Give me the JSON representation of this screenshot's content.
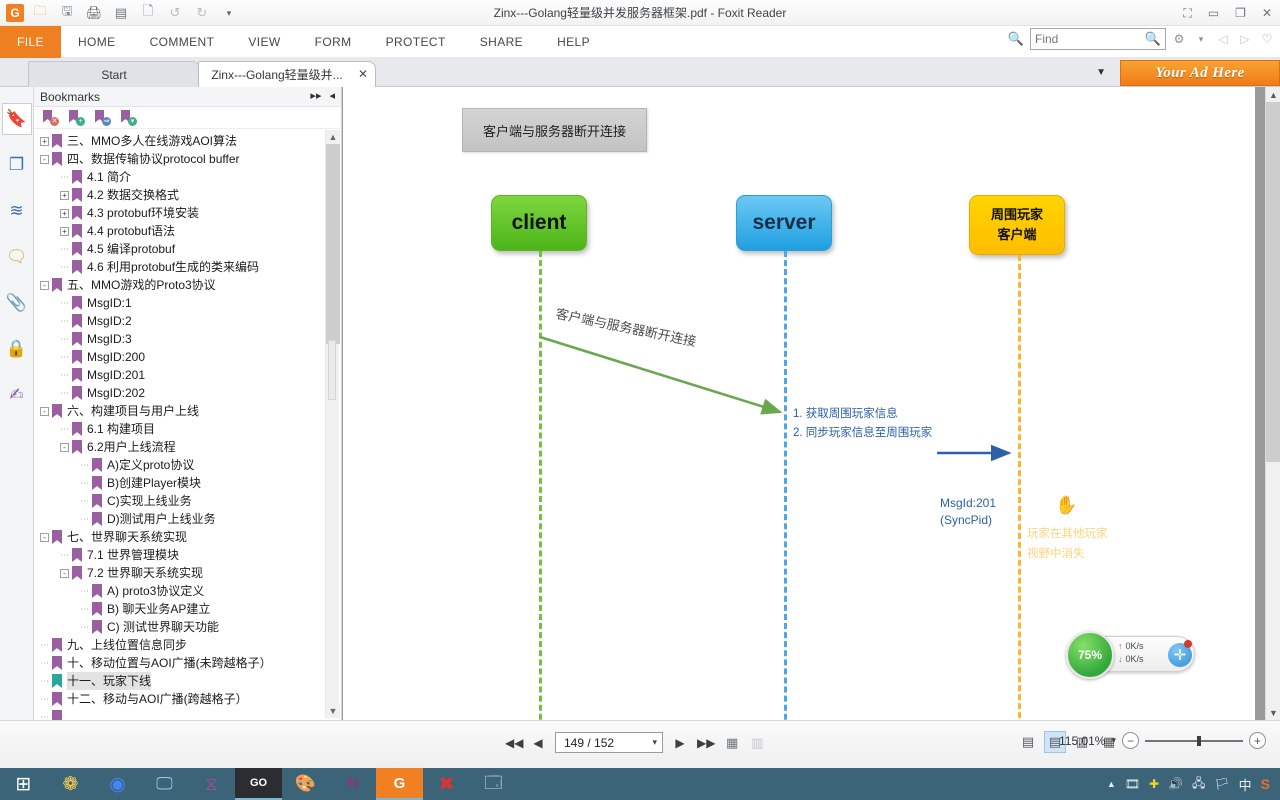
{
  "window": {
    "title": "Zinx---Golang轻量级并发服务器框架.pdf - Foxit Reader",
    "quick_access": [
      {
        "name": "foxit-logo-icon",
        "glyph": "G"
      },
      {
        "name": "open-icon",
        "glyph": "🗁"
      },
      {
        "name": "save-icon",
        "glyph": "🖫"
      },
      {
        "name": "print-icon",
        "glyph": "🖨"
      },
      {
        "name": "email-icon",
        "glyph": "🖹"
      },
      {
        "name": "create-pdf-icon",
        "glyph": "🗋"
      },
      {
        "name": "undo-icon",
        "glyph": "↺"
      },
      {
        "name": "redo-icon",
        "glyph": "↻"
      },
      {
        "name": "customize-qat-icon",
        "glyph": "▾"
      }
    ],
    "controls": [
      {
        "name": "restore-layout-icon",
        "glyph": "⛶"
      },
      {
        "name": "minimize-icon",
        "glyph": "▭"
      },
      {
        "name": "maximize-icon",
        "glyph": "❐"
      },
      {
        "name": "close-icon",
        "glyph": "✕"
      }
    ]
  },
  "ribbon": {
    "tabs": [
      {
        "label": "FILE",
        "active": true
      },
      {
        "label": "HOME",
        "active": false
      },
      {
        "label": "COMMENT",
        "active": false
      },
      {
        "label": "VIEW",
        "active": false
      },
      {
        "label": "FORM",
        "active": false
      },
      {
        "label": "PROTECT",
        "active": false
      },
      {
        "label": "SHARE",
        "active": false
      },
      {
        "label": "HELP",
        "active": false
      }
    ],
    "find_placeholder": "Find",
    "find_value": "",
    "right_icons": [
      {
        "name": "settings-gear-icon",
        "glyph": "⚙"
      },
      {
        "name": "settings-dropdown-icon",
        "glyph": "▾"
      },
      {
        "name": "previous-view-icon",
        "glyph": "◁"
      },
      {
        "name": "next-view-icon",
        "glyph": "▷"
      },
      {
        "name": "favorite-heart-icon",
        "glyph": "♡"
      }
    ]
  },
  "doc_tabs": {
    "tabs": [
      {
        "label": "Start",
        "active": false,
        "closable": false
      },
      {
        "label": "Zinx---Golang轻量级并...",
        "active": true,
        "closable": true
      }
    ],
    "close_glyph": "✕",
    "overflow_glyph": "▼",
    "ad_label": "Your Ad Here"
  },
  "rail": {
    "items": [
      {
        "name": "bookmarks-panel-icon",
        "glyph": "🔖",
        "selected": true
      },
      {
        "name": "page-thumbnails-icon",
        "glyph": "❏",
        "selected": false
      },
      {
        "name": "layers-panel-icon",
        "glyph": "▤",
        "selected": false
      },
      {
        "name": "comments-panel-icon",
        "glyph": "🗩",
        "selected": false
      },
      {
        "name": "attachments-panel-icon",
        "glyph": "📎",
        "selected": false
      },
      {
        "name": "security-panel-icon",
        "glyph": "🔒",
        "selected": false
      },
      {
        "name": "signatures-panel-icon",
        "glyph": "✍",
        "selected": false
      }
    ]
  },
  "bookmarks": {
    "header": "Bookmarks",
    "header_icons": [
      {
        "name": "expand-panel-icon",
        "glyph": "▸▸"
      },
      {
        "name": "collapse-panel-icon",
        "glyph": "◂"
      }
    ],
    "toolbar": [
      {
        "name": "delete-bookmark-icon",
        "badge": "red",
        "glyph": "✕"
      },
      {
        "name": "new-bookmark-icon",
        "badge": "green",
        "glyph": "+"
      },
      {
        "name": "expand-bookmark-icon",
        "badge": "blue",
        "glyph": "⇒"
      },
      {
        "name": "bookmark-options-icon",
        "badge": "green",
        "glyph": "▾"
      }
    ],
    "items": [
      {
        "label": "三、MMO多人在线游戏AOI算法",
        "indent": 0,
        "toggle": "+",
        "selected": false
      },
      {
        "label": "四、数据传输协议protocol buffer",
        "indent": 0,
        "toggle": "-",
        "selected": false
      },
      {
        "label": "4.1 简介",
        "indent": 1,
        "toggle": "",
        "selected": false
      },
      {
        "label": "4.2 数据交换格式",
        "indent": 1,
        "toggle": "+",
        "selected": false
      },
      {
        "label": "4.3 protobuf环境安装",
        "indent": 1,
        "toggle": "+",
        "selected": false
      },
      {
        "label": "4.4 protobuf语法",
        "indent": 1,
        "toggle": "+",
        "selected": false
      },
      {
        "label": "4.5 编译protobuf",
        "indent": 1,
        "toggle": "",
        "selected": false
      },
      {
        "label": "4.6 利用protobuf生成的类来编码",
        "indent": 1,
        "toggle": "",
        "selected": false
      },
      {
        "label": "五、MMO游戏的Proto3协议",
        "indent": 0,
        "toggle": "-",
        "selected": false
      },
      {
        "label": "MsgID:1",
        "indent": 1,
        "toggle": "",
        "selected": false
      },
      {
        "label": "MsgID:2",
        "indent": 1,
        "toggle": "",
        "selected": false
      },
      {
        "label": "MsgID:3",
        "indent": 1,
        "toggle": "",
        "selected": false
      },
      {
        "label": "MsgID:200",
        "indent": 1,
        "toggle": "",
        "selected": false
      },
      {
        "label": "MsgID:201",
        "indent": 1,
        "toggle": "",
        "selected": false
      },
      {
        "label": "MsgID:202",
        "indent": 1,
        "toggle": "",
        "selected": false
      },
      {
        "label": "六、构建项目与用户上线",
        "indent": 0,
        "toggle": "-",
        "selected": false
      },
      {
        "label": "6.1 构建项目",
        "indent": 1,
        "toggle": "",
        "selected": false
      },
      {
        "label": "6.2用户上线流程",
        "indent": 1,
        "toggle": "-",
        "selected": false
      },
      {
        "label": "A)定义proto协议",
        "indent": 2,
        "toggle": "",
        "selected": false
      },
      {
        "label": "B)创建Player模块",
        "indent": 2,
        "toggle": "",
        "selected": false
      },
      {
        "label": "C)实现上线业务",
        "indent": 2,
        "toggle": "",
        "selected": false
      },
      {
        "label": "D)测试用户上线业务",
        "indent": 2,
        "toggle": "",
        "selected": false
      },
      {
        "label": "七、世界聊天系统实现",
        "indent": 0,
        "toggle": "-",
        "selected": false
      },
      {
        "label": "7.1 世界管理模块",
        "indent": 1,
        "toggle": "",
        "selected": false
      },
      {
        "label": "7.2 世界聊天系统实现",
        "indent": 1,
        "toggle": "-",
        "selected": false
      },
      {
        "label": "A) proto3协议定义",
        "indent": 2,
        "toggle": "",
        "selected": false
      },
      {
        "label": "B) 聊天业务AP建立",
        "indent": 2,
        "toggle": "",
        "selected": false
      },
      {
        "label": "C) 测试世界聊天功能",
        "indent": 2,
        "toggle": "",
        "selected": false
      },
      {
        "label": "九、上线位置信息同步",
        "indent": 0,
        "toggle": "",
        "selected": false
      },
      {
        "label": "十、移动位置与AOI广播(未跨越格子）",
        "indent": 0,
        "toggle": "",
        "selected": false
      },
      {
        "label": "十一、玩家下线",
        "indent": 0,
        "toggle": "",
        "selected": true,
        "teal": true
      },
      {
        "label": "十二、移动与AOI广播(跨越格子）",
        "indent": 0,
        "toggle": "",
        "selected": false
      },
      {
        "label": "",
        "indent": 0,
        "toggle": "",
        "selected": false
      }
    ]
  },
  "document": {
    "caption": "客户端与服务器断开连接",
    "nodes": [
      {
        "name": "client-node",
        "label": "client",
        "color": "#5cc225"
      },
      {
        "name": "server-node",
        "label": "server",
        "color": "#2f9ed6"
      },
      {
        "name": "peer-client-node",
        "line1": "周围玩家",
        "line2": "客户端",
        "color": "#ffc800"
      }
    ],
    "arrow_label": "客户端与服务器断开连接",
    "notes": [
      "1. 获取周围玩家信息",
      "2. 同步玩家信息至周围玩家"
    ],
    "msgid_line1": "MsgId:201",
    "msgid_line2": "(SyncPid)",
    "peer_note_line1": "玩家在其他玩家",
    "peer_note_line2": "视野中消失",
    "cursor_icon": "✋"
  },
  "speed_widget": {
    "percent": "75%",
    "up_rate": "0K/s",
    "down_rate": "0K/s",
    "up_arrow": "↑",
    "down_arrow": "↓",
    "plus_glyph": "✛"
  },
  "bottom_toolbar": {
    "first_page_icon": "◀◀",
    "prev_page_icon": "◀",
    "page_value": "149 / 152",
    "page_dropdown_icon": "▾",
    "next_page_icon": "▶",
    "last_page_icon": "▶▶",
    "fit_page_icon": "▦",
    "fit_width_icon": "▥",
    "view_modes": [
      {
        "name": "single-page-view-icon",
        "glyph": "▤",
        "active": false
      },
      {
        "name": "continuous-page-view-icon",
        "glyph": "▤",
        "active": true
      },
      {
        "name": "facing-page-view-icon",
        "glyph": "▥",
        "active": false
      },
      {
        "name": "continuous-facing-view-icon",
        "glyph": "▦",
        "active": false
      }
    ],
    "zoom_value": "115.01%",
    "zoom_caret": "▾",
    "zoom_out_icon": "−",
    "zoom_in_icon": "+"
  },
  "taskbar": {
    "items": [
      {
        "name": "windows-start-icon",
        "glyph": "⊞",
        "active": false
      },
      {
        "name": "media-player-icon",
        "glyph": "❁",
        "active": false
      },
      {
        "name": "chrome-icon",
        "glyph": "◉",
        "active": false
      },
      {
        "name": "remote-desktop-icon",
        "glyph": "🖥",
        "active": false
      },
      {
        "name": "visual-studio-icon",
        "glyph": "✖",
        "active": false
      },
      {
        "name": "goland-icon",
        "glyph": "GO",
        "active": true
      },
      {
        "name": "paint-icon",
        "glyph": "🎨",
        "active": false
      },
      {
        "name": "onenote-icon",
        "glyph": "N",
        "active": false
      },
      {
        "name": "foxit-reader-icon",
        "glyph": "G",
        "active": true
      },
      {
        "name": "xmind-icon",
        "glyph": "✖",
        "active": false
      },
      {
        "name": "screenshot-tool-icon",
        "glyph": "🗔",
        "active": false
      }
    ],
    "tray": [
      {
        "name": "show-hidden-icons",
        "glyph": "▲"
      },
      {
        "name": "video-recorder-icon",
        "glyph": "🎞"
      },
      {
        "name": "update-icon",
        "glyph": "✚"
      },
      {
        "name": "volume-icon",
        "glyph": "🔊"
      },
      {
        "name": "network-icon",
        "glyph": "🖧"
      },
      {
        "name": "action-center-icon",
        "glyph": "🏳"
      },
      {
        "name": "ime-language-icon",
        "glyph": "中"
      },
      {
        "name": "sogou-input-icon",
        "glyph": "S"
      }
    ]
  }
}
